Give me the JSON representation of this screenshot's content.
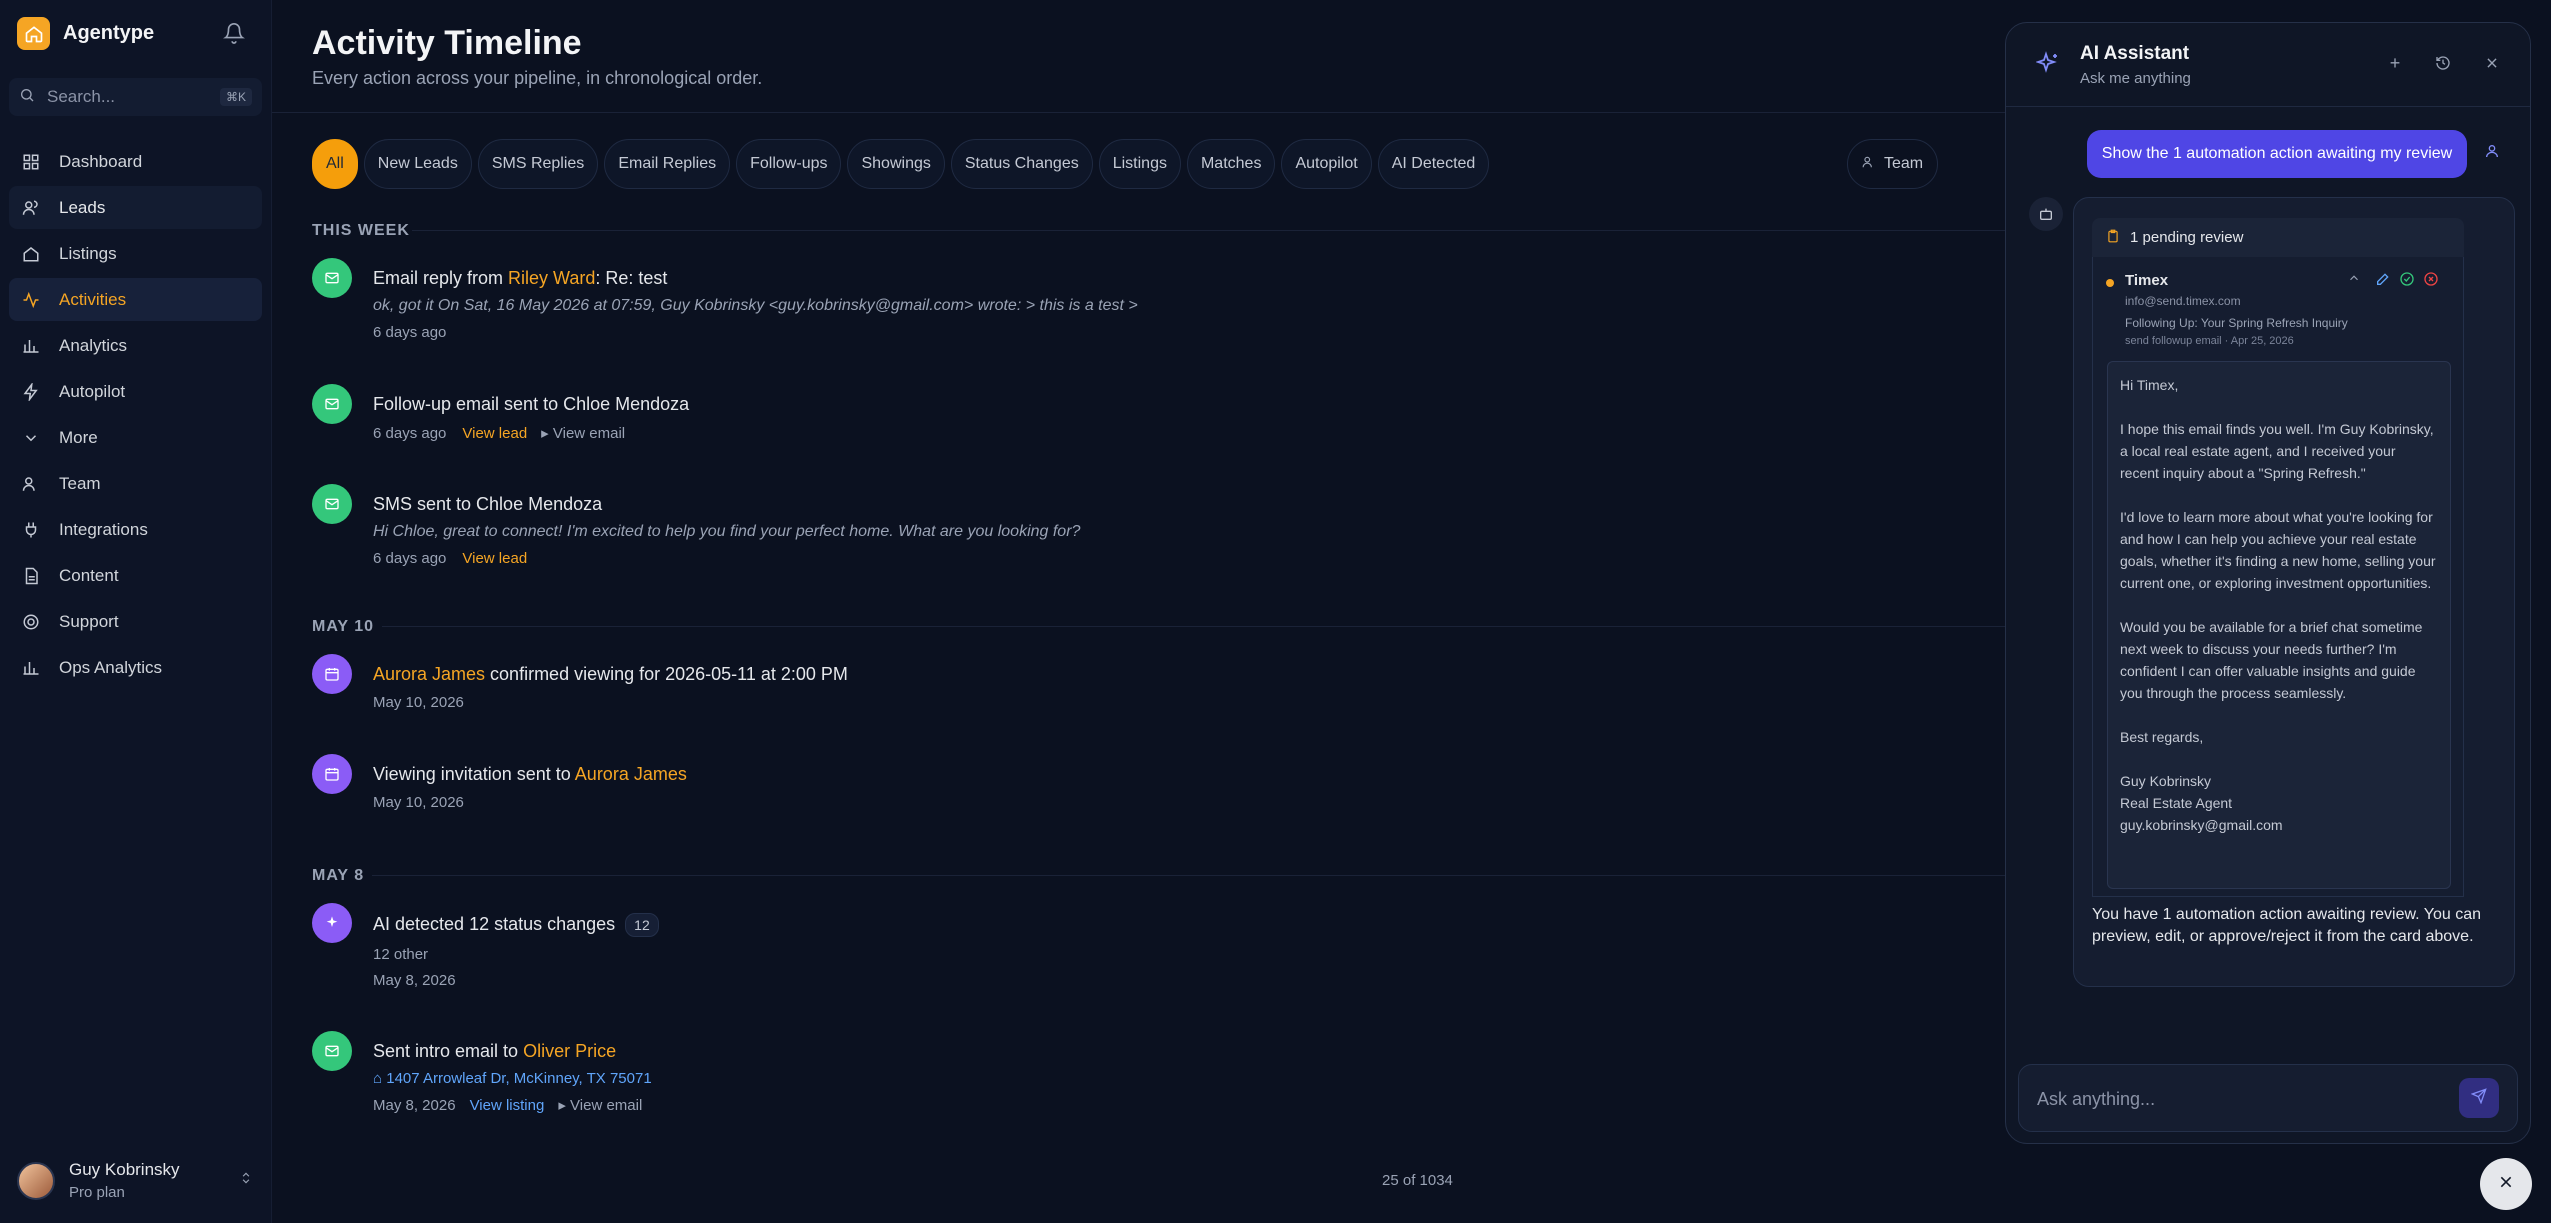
{
  "app": {
    "name": "Agentype"
  },
  "search": {
    "placeholder": "Search...",
    "shortcut": "⌘K"
  },
  "nav": [
    {
      "label": "Dashboard",
      "icon": "grid-icon"
    },
    {
      "label": "Leads",
      "icon": "users-icon"
    },
    {
      "label": "Listings",
      "icon": "home-icon"
    },
    {
      "label": "Activities",
      "icon": "activity-icon"
    },
    {
      "label": "Analytics",
      "icon": "bar-chart-icon"
    },
    {
      "label": "Autopilot",
      "icon": "zap-icon"
    },
    {
      "label": "More",
      "icon": "chevron-down-icon"
    },
    {
      "label": "Team",
      "icon": "team-icon"
    },
    {
      "label": "Integrations",
      "icon": "plug-icon"
    },
    {
      "label": "Content",
      "icon": "file-icon"
    },
    {
      "label": "Support",
      "icon": "lifebuoy-icon"
    },
    {
      "label": "Ops Analytics",
      "icon": "bar-chart-icon"
    }
  ],
  "user": {
    "name": "Guy Kobrinsky",
    "plan": "Pro plan"
  },
  "page": {
    "title": "Activity Timeline",
    "subtitle": "Every action across your pipeline, in chronological order."
  },
  "filters": [
    "All",
    "New Leads",
    "SMS Replies",
    "Email Replies",
    "Follow-ups",
    "Showings",
    "Status Changes",
    "Listings",
    "Matches",
    "Autopilot",
    "AI Detected"
  ],
  "team_filter": "Team",
  "sections": {
    "this_week": "THIS WEEK",
    "may10": "MAY 10",
    "may8": "MAY 8"
  },
  "events": {
    "e1": {
      "prefix": "Email reply from ",
      "name": "Riley Ward",
      "suffix": ": Re: test",
      "quote": "ok, got it On Sat, 16 May 2026 at 07:59, Guy Kobrinsky <guy.kobrinsky@gmail.com> wrote: > this is a test >",
      "time": "6 days ago"
    },
    "e2": {
      "title": "Follow-up email sent to Chloe Mendoza",
      "time": "6 days ago",
      "view_lead": "View lead",
      "view_email": "View email"
    },
    "e3": {
      "title": "SMS sent to Chloe Mendoza",
      "quote": "Hi Chloe, great to connect! I'm excited to help you find your perfect home. What are you looking for?",
      "time": "6 days ago",
      "view_lead": "View lead"
    },
    "e4": {
      "name": "Aurora James",
      "suffix": " confirmed viewing for 2026-05-11 at 2:00 PM",
      "time": "May 10, 2026"
    },
    "e5": {
      "prefix": "Viewing invitation sent to ",
      "name": "Aurora James",
      "time": "May 10, 2026"
    },
    "e6": {
      "title": "AI detected 12 status changes",
      "badge": "12",
      "detail": "12 other",
      "time": "May 8, 2026"
    },
    "e7": {
      "prefix": "Sent intro email to ",
      "name": "Oliver Price",
      "address": "1407 Arrowleaf Dr, McKinney, TX 75071",
      "time": "May 8, 2026",
      "view_listing": "View listing",
      "view_email": "View email"
    }
  },
  "pager": "25 of 1034",
  "assistant": {
    "title": "AI Assistant",
    "subtitle": "Ask me anything",
    "user_message": "Show the 1 automation action awaiting my review",
    "pending_label": "1 pending review",
    "item": {
      "name": "Timex",
      "email": "info@send.timex.com",
      "subject": "Following Up: Your Spring Refresh Inquiry",
      "meta": "send followup email · Apr 25, 2026",
      "body": "Hi Timex,\n\nI hope this email finds you well. I'm Guy Kobrinsky, a local real estate agent, and I received your recent inquiry about a \"Spring Refresh.\"\n\nI'd love to learn more about what you're looking for and how I can help you achieve your real estate goals, whether it's finding a new home, selling your current one, or exploring investment opportunities.\n\nWould you be available for a brief chat sometime next week to discuss your needs further? I'm confident I can offer valuable insights and guide you through the process seamlessly.\n\nBest regards,\n\nGuy Kobrinsky\nReal Estate Agent\nguy.kobrinsky@gmail.com"
    },
    "reply": "You have 1 automation action awaiting review. You can preview, edit, or approve/reject it from the card above.",
    "input_placeholder": "Ask anything..."
  },
  "colors": {
    "accent": "#f59e0b",
    "primary": "#4f46e5",
    "success": "#34c77b",
    "violet": "#8b5cf6",
    "link": "#60a5fa"
  }
}
